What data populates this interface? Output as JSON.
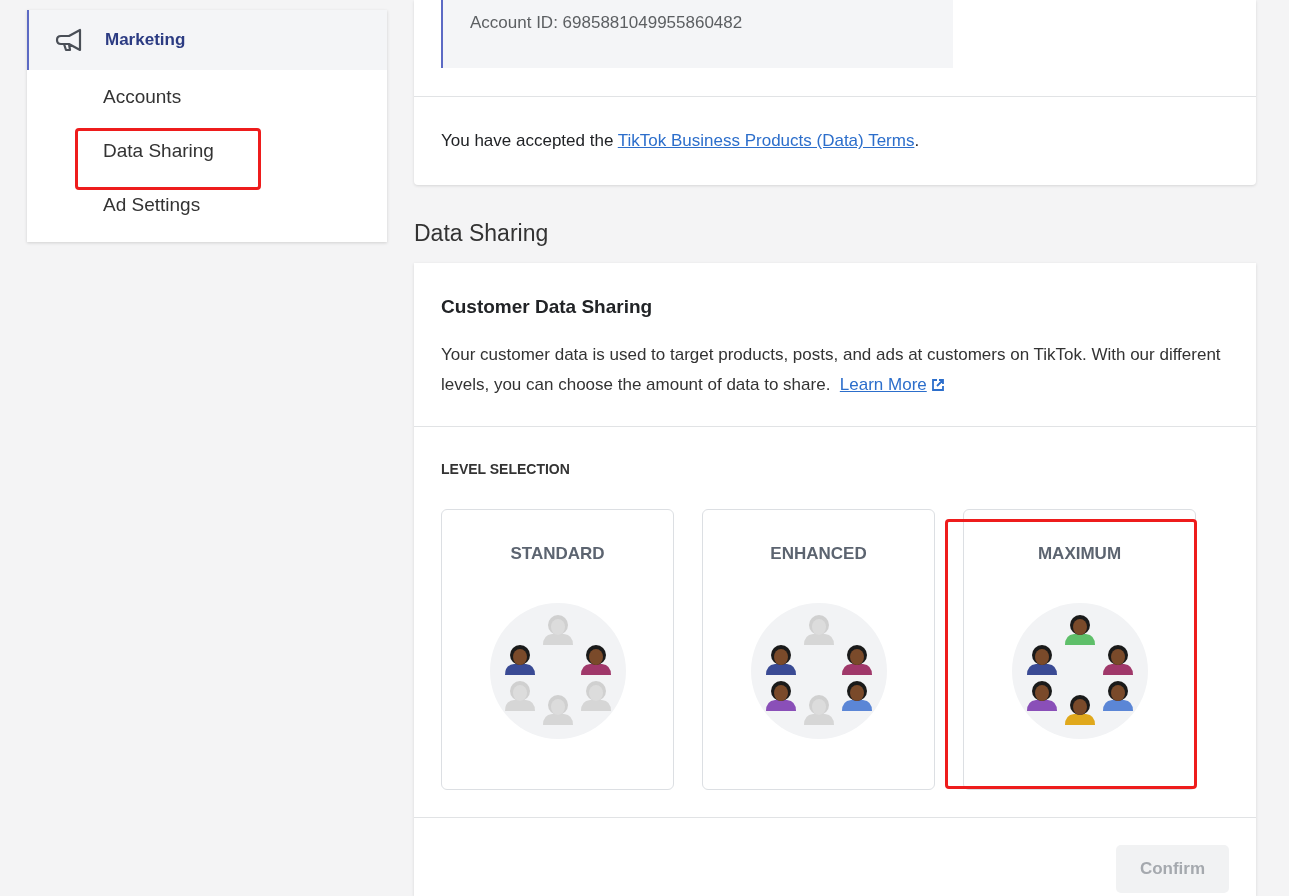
{
  "sidebar": {
    "section": {
      "label": "Marketing",
      "selected": true
    },
    "items": [
      {
        "label": "Accounts",
        "selected": false,
        "highlighted": false
      },
      {
        "label": "Data Sharing",
        "selected": false,
        "highlighted": true
      },
      {
        "label": "Ad Settings",
        "selected": false,
        "highlighted": false
      }
    ]
  },
  "account": {
    "id_text": "Account ID: 6985881049955860482",
    "terms_prefix": "You have accepted the ",
    "terms_link": "TikTok Business Products (Data) Terms",
    "terms_suffix": "."
  },
  "data_sharing": {
    "heading": "Data Sharing",
    "card_title": "Customer Data Sharing",
    "description": "Your customer data is used to target products, posts, and ads at customers on TikTok. With our different levels, you can choose the amount of data to share.",
    "learn_more": "Learn More",
    "level_label": "LEVEL SELECTION",
    "levels": [
      {
        "name": "STANDARD",
        "highlighted": false,
        "people": [
          {
            "active": true,
            "color": "#3a4a94"
          },
          {
            "active": false,
            "color": "#d6d6d6"
          },
          {
            "active": true,
            "color": "#a0386a"
          },
          {
            "active": false,
            "color": "#d6d6d6"
          },
          {
            "active": false,
            "color": "#d6d6d6"
          },
          {
            "active": false,
            "color": "#d6d6d6"
          }
        ]
      },
      {
        "name": "ENHANCED",
        "highlighted": false,
        "people": [
          {
            "active": true,
            "color": "#3a4a94"
          },
          {
            "active": false,
            "color": "#d6d6d6"
          },
          {
            "active": true,
            "color": "#a0386a"
          },
          {
            "active": true,
            "color": "#8a4fb8"
          },
          {
            "active": false,
            "color": "#d6d6d6"
          },
          {
            "active": true,
            "color": "#5b86d6"
          }
        ]
      },
      {
        "name": "MAXIMUM",
        "highlighted": true,
        "people": [
          {
            "active": true,
            "color": "#3a4a94"
          },
          {
            "active": true,
            "color": "#5fbf6a"
          },
          {
            "active": true,
            "color": "#a0386a"
          },
          {
            "active": true,
            "color": "#8a4fb8"
          },
          {
            "active": true,
            "color": "#e0a81c"
          },
          {
            "active": true,
            "color": "#5b86d6"
          }
        ]
      }
    ],
    "confirm": {
      "label": "Confirm",
      "disabled": true
    }
  }
}
